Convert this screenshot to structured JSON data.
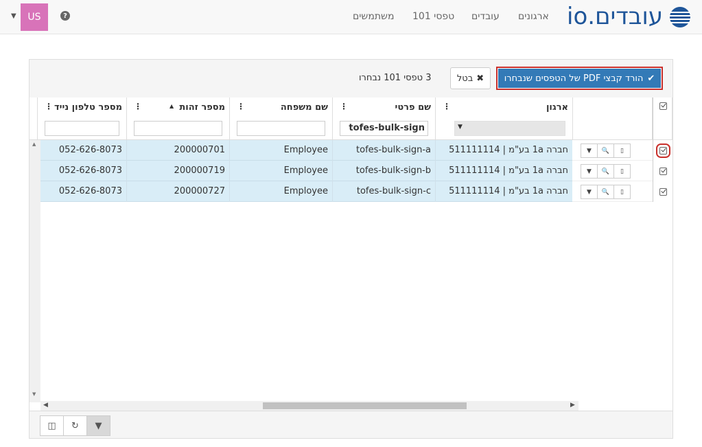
{
  "header": {
    "brand": "עובדים.io",
    "user_initials": "US",
    "help_icon": "question-icon",
    "nav": [
      "משתמשים",
      "טפסי 101",
      "עובדים",
      "ארגונים"
    ]
  },
  "toolbar": {
    "download_label": "הורד קבצי PDF של הטפסים שנבחרו",
    "cancel_label": "בטל",
    "selection_text": "3 טפסי 101 נבחרו"
  },
  "columns": {
    "phone": "מספר טלפון נייד",
    "id_number": "מספר זהות",
    "last_name": "שם משפחה",
    "first_name": "שם פרטי",
    "organization": "ארגון"
  },
  "filters": {
    "first_name_value": "tofes-bulk-sign"
  },
  "rows": [
    {
      "phone": "052-626-8073",
      "id": "200000701",
      "last": "Employee",
      "first": "tofes-bulk-sign-a",
      "org": "חברה 1a בע\"מ | 511111114"
    },
    {
      "phone": "052-626-8073",
      "id": "200000719",
      "last": "Employee",
      "first": "tofes-bulk-sign-b",
      "org": "חברה 1a בע\"מ | 511111114"
    },
    {
      "phone": "052-626-8073",
      "id": "200000727",
      "last": "Employee",
      "first": "tofes-bulk-sign-c",
      "org": "חברה 1a בע\"מ | 511111114"
    }
  ],
  "colors": {
    "primary": "#337ab7",
    "avatar": "#d873b9",
    "row_selected": "#d9edf7",
    "brand": "#1e5599"
  }
}
